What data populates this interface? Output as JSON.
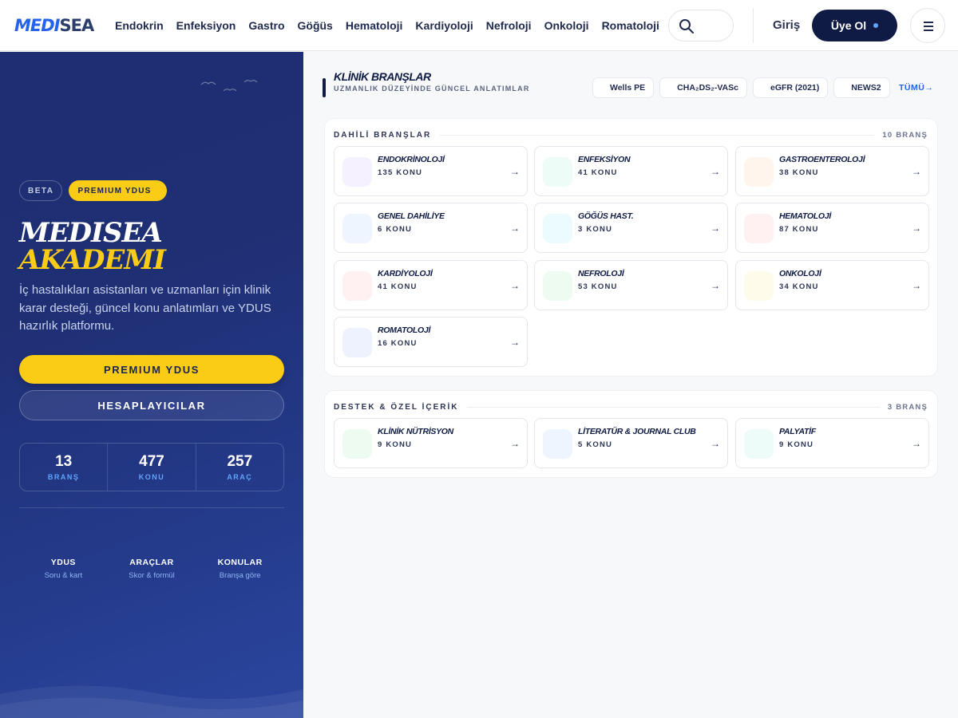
{
  "header": {
    "logo_part1": "MEDI",
    "logo_part2": "SEA",
    "nav": [
      "Endokrin",
      "Enfeksiyon",
      "Gastro",
      "Göğüs",
      "Hematoloji",
      "Kardiyoloji",
      "Nefroloji",
      "Onkoloji",
      "Romatoloji"
    ],
    "login_label": "Giriş",
    "signup_label": "Üye Ol"
  },
  "hero": {
    "badge_beta": "BETA",
    "badge_premium": "PREMIUM YDUS",
    "title_line1": "MEDISEA",
    "title_line2": "AKADEMI",
    "intro": "İç hastalıkları asistanları ve uzmanları için klinik karar desteği, güncel konu anlatımları ve YDUS hazırlık platformu.",
    "primary_button": "PREMIUM YDUS",
    "secondary_button": "HESAPLAYICILAR",
    "stats": [
      {
        "value": "13",
        "label": "BRANŞ"
      },
      {
        "value": "477",
        "label": "KONU"
      },
      {
        "value": "257",
        "label": "ARAÇ"
      }
    ],
    "features": [
      {
        "title": "YDUS",
        "subtitle": "Soru & kart"
      },
      {
        "title": "ARAÇLAR",
        "subtitle": "Skor & formül"
      },
      {
        "title": "KONULAR",
        "subtitle": "Branşa göre"
      }
    ]
  },
  "section": {
    "title": "KLİNİK BRANŞLAR",
    "subtitle": "UZMANLIK DÜZEYİNDE GÜNCEL ANLATIMLAR",
    "quick_tools": [
      "Wells PE",
      "CHA₂DS₂-VASc",
      "eGFR (2021)",
      "NEWS2"
    ],
    "all_link": "TÜMÜ→"
  },
  "groups": [
    {
      "title": "DAHİLİ BRANŞLAR",
      "count": "10 BRANŞ",
      "items": [
        {
          "name": "ENDOKRİNOLOJİ",
          "topics": "135 KONU",
          "icon_color": "#f6f1ff"
        },
        {
          "name": "ENFEKSİYON",
          "topics": "41 KONU",
          "icon_color": "#eefcf7"
        },
        {
          "name": "GASTROENTEROLOJİ",
          "topics": "38 KONU",
          "icon_color": "#fff5ec"
        },
        {
          "name": "GENEL DAHİLİYE",
          "topics": "6 KONU",
          "icon_color": "#eff5ff"
        },
        {
          "name": "GÖĞÜS HAST.",
          "topics": "3 KONU",
          "icon_color": "#ecfbfd"
        },
        {
          "name": "HEMATOLOJİ",
          "topics": "87 KONU",
          "icon_color": "#fff0f1"
        },
        {
          "name": "KARDİYOLOJİ",
          "topics": "41 KONU",
          "icon_color": "#fff1f1"
        },
        {
          "name": "NEFROLOJİ",
          "topics": "53 KONU",
          "icon_color": "#edfbf1"
        },
        {
          "name": "ONKOLOJİ",
          "topics": "34 KONU",
          "icon_color": "#fffbeb"
        },
        {
          "name": "ROMATOLOJİ",
          "topics": "16 KONU",
          "icon_color": "#eef2ff"
        }
      ]
    },
    {
      "title": "DESTEK & ÖZEL İÇERİK",
      "count": "3 BRANŞ",
      "items": [
        {
          "name": "KLİNİK NÜTRİSYON",
          "topics": "9 KONU",
          "icon_color": "#edfbf1"
        },
        {
          "name": "LİTERATÜR & JOURNAL CLUB",
          "topics": "5 KONU",
          "icon_color": "#eff5ff"
        },
        {
          "name": "PALYATİF",
          "topics": "9 KONU",
          "icon_color": "#eefcf9"
        }
      ]
    }
  ]
}
